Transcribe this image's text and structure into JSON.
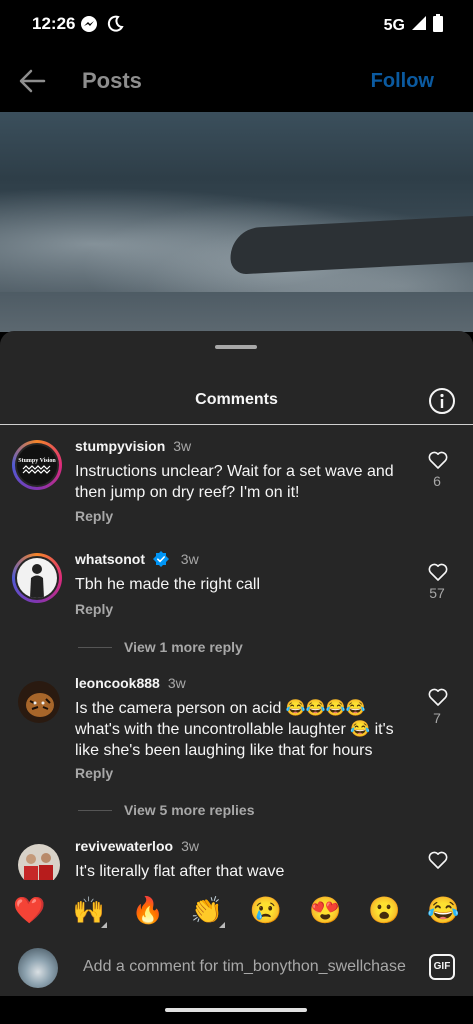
{
  "status": {
    "time": "12:26",
    "network": "5G"
  },
  "header": {
    "title": "Posts",
    "follow_label": "Follow"
  },
  "sheet": {
    "title": "Comments"
  },
  "comments": [
    {
      "user": "stumpyvision",
      "time": "3w",
      "text": "Instructions unclear? Wait for a set wave and then jump on dry reef? I'm on it!",
      "reply": "Reply",
      "likes": "6",
      "avatar_text": "Stumpy Vision"
    },
    {
      "user": "whatsonot",
      "time": "3w",
      "text": "Tbh he made the right call",
      "reply": "Reply",
      "likes": "57",
      "verified": true
    },
    {
      "user": "leoncook888",
      "time": "3w",
      "text": "Is the camera person on acid 😂😂😂😂 what's with the uncontrollable laughter 😂 it's like she's been laughing like that for hours",
      "reply": "Reply",
      "likes": "7"
    },
    {
      "user": "revivewaterloo",
      "time": "3w",
      "text": "It's literally flat after that wave"
    }
  ],
  "view_more": [
    "View 1 more reply",
    "View 5 more replies"
  ],
  "emojis": [
    "❤️",
    "🙌",
    "🔥",
    "👏",
    "😢",
    "😍",
    "😮",
    "😂"
  ],
  "composer": {
    "placeholder": "Add a comment for tim_bonython_swellchase",
    "gif_label": "GIF"
  },
  "colors": {
    "follow": "#0b5aa0",
    "sheet": "#262626",
    "verified": "#0095f6"
  }
}
